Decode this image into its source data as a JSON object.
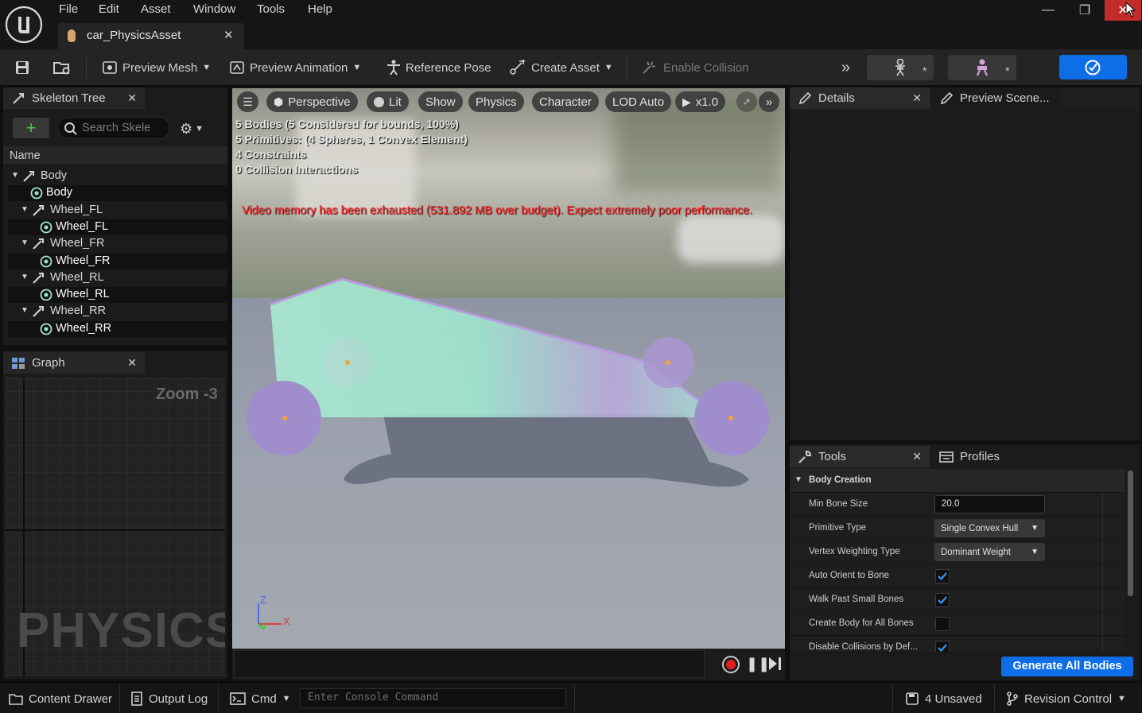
{
  "menu": [
    "File",
    "Edit",
    "Asset",
    "Window",
    "Tools",
    "Help"
  ],
  "window": {
    "tab_title": "car_PhysicsAsset"
  },
  "toolbar": {
    "preview_mesh": "Preview Mesh",
    "preview_animation": "Preview Animation",
    "reference_pose": "Reference Pose",
    "create_asset": "Create Asset",
    "enable_collision": "Enable Collision"
  },
  "skeleton_tree": {
    "tab": "Skeleton Tree",
    "search_placeholder": "Search Skele",
    "column_name": "Name",
    "items": [
      {
        "label": "Body",
        "kind": "bone"
      },
      {
        "label": "Body",
        "kind": "body"
      },
      {
        "label": "Wheel_FL",
        "kind": "bone"
      },
      {
        "label": "Wheel_FL",
        "kind": "body"
      },
      {
        "label": "Wheel_FR",
        "kind": "bone"
      },
      {
        "label": "Wheel_FR",
        "kind": "body"
      },
      {
        "label": "Wheel_RL",
        "kind": "bone"
      },
      {
        "label": "Wheel_RL",
        "kind": "body"
      },
      {
        "label": "Wheel_RR",
        "kind": "bone"
      },
      {
        "label": "Wheel_RR",
        "kind": "body"
      }
    ]
  },
  "graph": {
    "tab": "Graph",
    "zoom": "Zoom -3",
    "watermark": "PHYSICS"
  },
  "viewport": {
    "perspective": "Perspective",
    "lit": "Lit",
    "show": "Show",
    "physics": "Physics",
    "character": "Character",
    "lod": "LOD Auto",
    "speed": "x1.0",
    "stats": [
      "5 Bodies (5 Considered for bounds, 100%)",
      "5 Primitives: (4 Spheres, 1 Convex Element)",
      "4 Constraints",
      "0 Collision Interactions"
    ],
    "warning": "Video memory has been exhausted (531.892 MB over budget). Expect extremely poor performance.",
    "axis_z": "Z",
    "axis_x": "X",
    "axis_y": "Y"
  },
  "details": {
    "tab": "Details",
    "preview_tab": "Preview Scene..."
  },
  "tools": {
    "tab": "Tools",
    "profiles_tab": "Profiles",
    "section": "Body Creation",
    "min_bone_size_label": "Min Bone Size",
    "min_bone_size_value": "20.0",
    "primitive_type_label": "Primitive Type",
    "primitive_type_value": "Single Convex Hull",
    "vertex_weighting_label": "Vertex Weighting Type",
    "vertex_weighting_value": "Dominant Weight",
    "auto_orient_label": "Auto Orient to Bone",
    "auto_orient_checked": true,
    "walk_past_label": "Walk Past Small Bones",
    "walk_past_checked": true,
    "create_all_label": "Create Body for All Bones",
    "create_all_checked": false,
    "disable_collisions_label": "Disable Collisions by Def...",
    "disable_collisions_checked": true,
    "generate_button": "Generate All Bodies"
  },
  "statusbar": {
    "content_drawer": "Content Drawer",
    "output_log": "Output Log",
    "cmd": "Cmd",
    "console_placeholder": "Enter Console Command",
    "unsaved": "4 Unsaved",
    "revision_control": "Revision Control"
  },
  "colors": {
    "accent_blue": "#0e6ee8",
    "warning_red": "#ff2a2a",
    "hull_fill": "#9ee8cf",
    "sphere_fill": "#9a86c6"
  }
}
